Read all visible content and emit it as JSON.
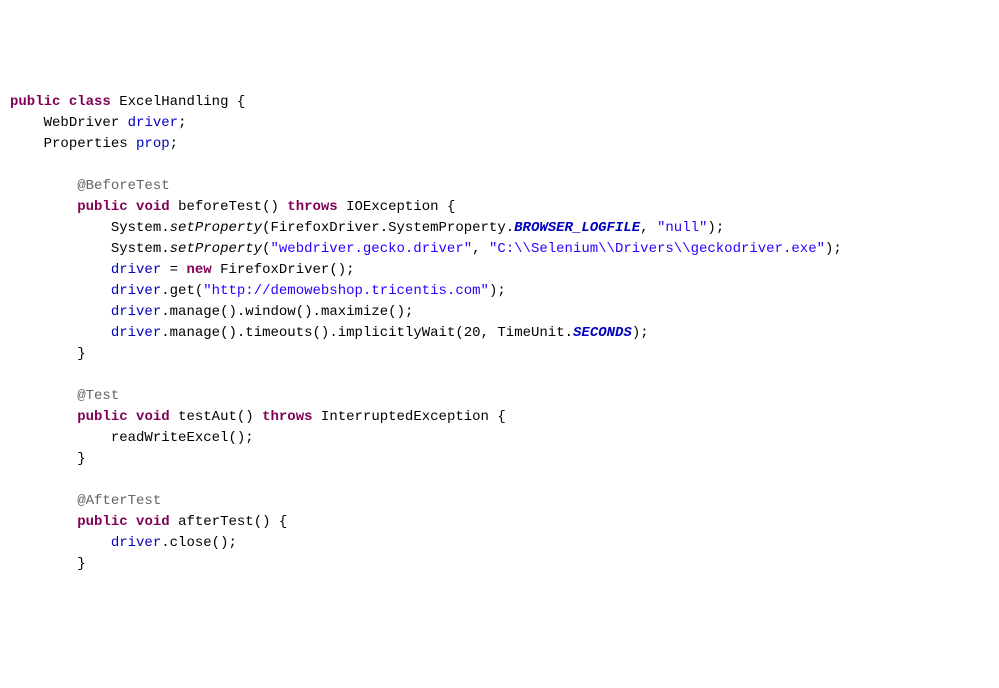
{
  "kw": {
    "public": "public",
    "class": "class",
    "void": "void",
    "throws": "throws",
    "new": "new"
  },
  "ann": {
    "before": "@BeforeTest",
    "test": "@Test",
    "after": "@AfterTest"
  },
  "id": {
    "className": "ExcelHandling",
    "WebDriver": "WebDriver",
    "driver": "driver",
    "Properties": "Properties",
    "prop": "prop",
    "beforeTest": "beforeTest",
    "IOException": "IOException",
    "System": "System",
    "setProperty": "setProperty",
    "FirefoxDriver": "FirefoxDriver",
    "SystemProperty": "SystemProperty",
    "BROWSER_LOGFILE": "BROWSER_LOGFILE",
    "get": "get",
    "manage": "manage",
    "window": "window",
    "maximize": "maximize",
    "timeouts": "timeouts",
    "implicitlyWait": "implicitlyWait",
    "TimeUnit": "TimeUnit",
    "SECONDS": "SECONDS",
    "testAut": "testAut",
    "InterruptedException": "InterruptedException",
    "readWriteExcel": "readWriteExcel",
    "afterTest": "afterTest",
    "close": "close"
  },
  "str": {
    "null": "\"null\"",
    "geckoProp": "\"webdriver.gecko.driver\"",
    "geckoPath": "\"C:\\\\Selenium\\\\Drivers\\\\geckodriver.exe\"",
    "url": "\"http://demowebshop.tricentis.com\""
  },
  "num": {
    "twenty": "20"
  },
  "punct": {
    "openBrace": "{",
    "closeBrace": "}",
    "semi": ";",
    "eq": "=",
    "lp": "(",
    "rp": ")",
    "dot": ".",
    "comma": ","
  }
}
